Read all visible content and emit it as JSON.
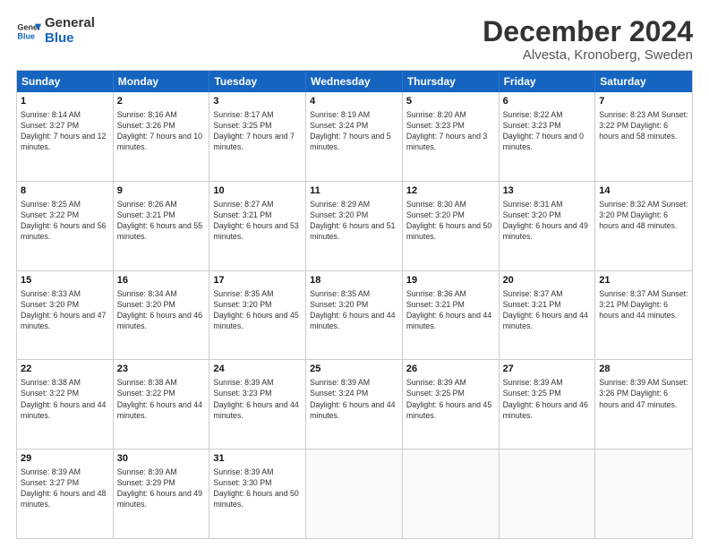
{
  "header": {
    "logo_line1": "General",
    "logo_line2": "Blue",
    "month": "December 2024",
    "location": "Alvesta, Kronoberg, Sweden"
  },
  "days_of_week": [
    "Sunday",
    "Monday",
    "Tuesday",
    "Wednesday",
    "Thursday",
    "Friday",
    "Saturday"
  ],
  "weeks": [
    [
      {
        "day": "1",
        "text": "Sunrise: 8:14 AM\nSunset: 3:27 PM\nDaylight: 7 hours\nand 12 minutes."
      },
      {
        "day": "2",
        "text": "Sunrise: 8:16 AM\nSunset: 3:26 PM\nDaylight: 7 hours\nand 10 minutes."
      },
      {
        "day": "3",
        "text": "Sunrise: 8:17 AM\nSunset: 3:25 PM\nDaylight: 7 hours\nand 7 minutes."
      },
      {
        "day": "4",
        "text": "Sunrise: 8:19 AM\nSunset: 3:24 PM\nDaylight: 7 hours\nand 5 minutes."
      },
      {
        "day": "5",
        "text": "Sunrise: 8:20 AM\nSunset: 3:23 PM\nDaylight: 7 hours\nand 3 minutes."
      },
      {
        "day": "6",
        "text": "Sunrise: 8:22 AM\nSunset: 3:23 PM\nDaylight: 7 hours\nand 0 minutes."
      },
      {
        "day": "7",
        "text": "Sunrise: 8:23 AM\nSunset: 3:22 PM\nDaylight: 6 hours\nand 58 minutes."
      }
    ],
    [
      {
        "day": "8",
        "text": "Sunrise: 8:25 AM\nSunset: 3:22 PM\nDaylight: 6 hours\nand 56 minutes."
      },
      {
        "day": "9",
        "text": "Sunrise: 8:26 AM\nSunset: 3:21 PM\nDaylight: 6 hours\nand 55 minutes."
      },
      {
        "day": "10",
        "text": "Sunrise: 8:27 AM\nSunset: 3:21 PM\nDaylight: 6 hours\nand 53 minutes."
      },
      {
        "day": "11",
        "text": "Sunrise: 8:29 AM\nSunset: 3:20 PM\nDaylight: 6 hours\nand 51 minutes."
      },
      {
        "day": "12",
        "text": "Sunrise: 8:30 AM\nSunset: 3:20 PM\nDaylight: 6 hours\nand 50 minutes."
      },
      {
        "day": "13",
        "text": "Sunrise: 8:31 AM\nSunset: 3:20 PM\nDaylight: 6 hours\nand 49 minutes."
      },
      {
        "day": "14",
        "text": "Sunrise: 8:32 AM\nSunset: 3:20 PM\nDaylight: 6 hours\nand 48 minutes."
      }
    ],
    [
      {
        "day": "15",
        "text": "Sunrise: 8:33 AM\nSunset: 3:20 PM\nDaylight: 6 hours\nand 47 minutes."
      },
      {
        "day": "16",
        "text": "Sunrise: 8:34 AM\nSunset: 3:20 PM\nDaylight: 6 hours\nand 46 minutes."
      },
      {
        "day": "17",
        "text": "Sunrise: 8:35 AM\nSunset: 3:20 PM\nDaylight: 6 hours\nand 45 minutes."
      },
      {
        "day": "18",
        "text": "Sunrise: 8:35 AM\nSunset: 3:20 PM\nDaylight: 6 hours\nand 44 minutes."
      },
      {
        "day": "19",
        "text": "Sunrise: 8:36 AM\nSunset: 3:21 PM\nDaylight: 6 hours\nand 44 minutes."
      },
      {
        "day": "20",
        "text": "Sunrise: 8:37 AM\nSunset: 3:21 PM\nDaylight: 6 hours\nand 44 minutes."
      },
      {
        "day": "21",
        "text": "Sunrise: 8:37 AM\nSunset: 3:21 PM\nDaylight: 6 hours\nand 44 minutes."
      }
    ],
    [
      {
        "day": "22",
        "text": "Sunrise: 8:38 AM\nSunset: 3:22 PM\nDaylight: 6 hours\nand 44 minutes."
      },
      {
        "day": "23",
        "text": "Sunrise: 8:38 AM\nSunset: 3:22 PM\nDaylight: 6 hours\nand 44 minutes."
      },
      {
        "day": "24",
        "text": "Sunrise: 8:39 AM\nSunset: 3:23 PM\nDaylight: 6 hours\nand 44 minutes."
      },
      {
        "day": "25",
        "text": "Sunrise: 8:39 AM\nSunset: 3:24 PM\nDaylight: 6 hours\nand 44 minutes."
      },
      {
        "day": "26",
        "text": "Sunrise: 8:39 AM\nSunset: 3:25 PM\nDaylight: 6 hours\nand 45 minutes."
      },
      {
        "day": "27",
        "text": "Sunrise: 8:39 AM\nSunset: 3:25 PM\nDaylight: 6 hours\nand 46 minutes."
      },
      {
        "day": "28",
        "text": "Sunrise: 8:39 AM\nSunset: 3:26 PM\nDaylight: 6 hours\nand 47 minutes."
      }
    ],
    [
      {
        "day": "29",
        "text": "Sunrise: 8:39 AM\nSunset: 3:27 PM\nDaylight: 6 hours\nand 48 minutes."
      },
      {
        "day": "30",
        "text": "Sunrise: 8:39 AM\nSunset: 3:29 PM\nDaylight: 6 hours\nand 49 minutes."
      },
      {
        "day": "31",
        "text": "Sunrise: 8:39 AM\nSunset: 3:30 PM\nDaylight: 6 hours\nand 50 minutes."
      },
      {
        "day": "",
        "text": ""
      },
      {
        "day": "",
        "text": ""
      },
      {
        "day": "",
        "text": ""
      },
      {
        "day": "",
        "text": ""
      }
    ]
  ]
}
